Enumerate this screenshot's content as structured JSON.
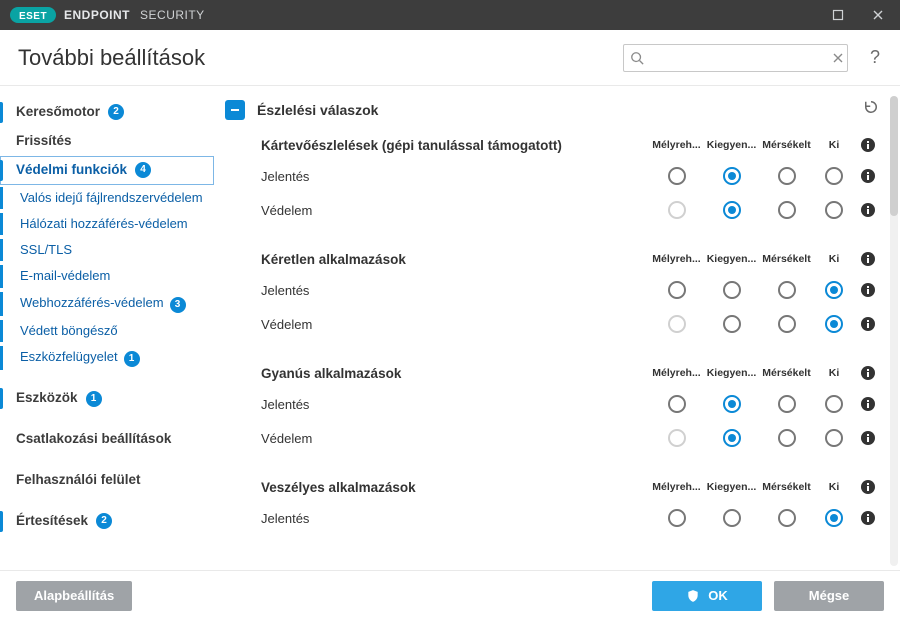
{
  "titlebar": {
    "brand": "ESET",
    "product1": "ENDPOINT",
    "product2": "SECURITY"
  },
  "header": {
    "title": "További beállítások",
    "search_placeholder": "",
    "help": "?"
  },
  "sidebar": {
    "items": [
      {
        "type": "top",
        "label": "Keresőmotor",
        "badge": "2",
        "bar": true
      },
      {
        "type": "top",
        "label": "Frissítés",
        "bar": false
      },
      {
        "type": "top",
        "label": "Védelmi funkciók",
        "badge": "4",
        "bar": true,
        "selected": true
      },
      {
        "type": "sub",
        "label": "Valós idejű fájlrendszervédelem",
        "bar": true
      },
      {
        "type": "sub",
        "label": "Hálózati hozzáférés-védelem",
        "bar": true
      },
      {
        "type": "sub",
        "label": "SSL/TLS",
        "bar": true
      },
      {
        "type": "sub",
        "label": "E-mail-védelem",
        "bar": true
      },
      {
        "type": "sub",
        "label": "Webhozzáférés-védelem",
        "badge": "3",
        "bar": true
      },
      {
        "type": "sub",
        "label": "Védett böngésző",
        "bar": true
      },
      {
        "type": "sub",
        "label": "Eszközfelügyelet",
        "badge": "1",
        "bar": true
      },
      {
        "type": "gap"
      },
      {
        "type": "top",
        "label": "Eszközök",
        "badge": "1",
        "bar": true
      },
      {
        "type": "gap"
      },
      {
        "type": "top",
        "label": "Csatlakozási beállítások",
        "bar": false
      },
      {
        "type": "gap"
      },
      {
        "type": "top",
        "label": "Felhasználói felület",
        "bar": false
      },
      {
        "type": "gap"
      },
      {
        "type": "top",
        "label": "Értesítések",
        "badge": "2",
        "bar": true
      }
    ]
  },
  "main": {
    "section_title": "Észlelési válaszok",
    "columns": [
      "Mélyreh...",
      "Kiegyen...",
      "Mérsékelt",
      "Ki"
    ],
    "groups": [
      {
        "title": "Kártevőészlelések (gépi tanulással támogatott)",
        "rows": [
          {
            "label": "Jelentés",
            "selected": 1,
            "disabled": []
          },
          {
            "label": "Védelem",
            "selected": 1,
            "disabled": [
              0
            ]
          }
        ]
      },
      {
        "title": "Kéretlen alkalmazások",
        "rows": [
          {
            "label": "Jelentés",
            "selected": 3,
            "disabled": []
          },
          {
            "label": "Védelem",
            "selected": 3,
            "disabled": [
              0
            ]
          }
        ]
      },
      {
        "title": "Gyanús alkalmazások",
        "rows": [
          {
            "label": "Jelentés",
            "selected": 1,
            "disabled": []
          },
          {
            "label": "Védelem",
            "selected": 1,
            "disabled": [
              0
            ]
          }
        ]
      },
      {
        "title": "Veszélyes alkalmazások",
        "rows": [
          {
            "label": "Jelentés",
            "selected": 3,
            "disabled": []
          }
        ]
      }
    ]
  },
  "footer": {
    "default": "Alapbeállítás",
    "ok": "OK",
    "cancel": "Mégse"
  }
}
